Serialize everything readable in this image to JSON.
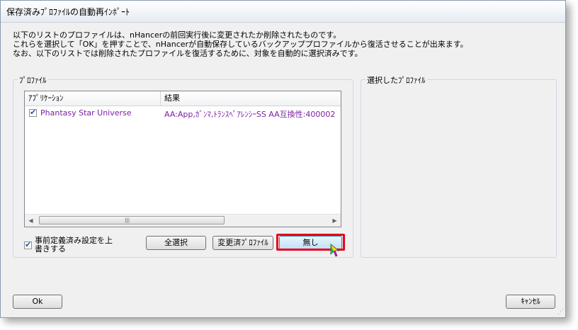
{
  "window": {
    "title": "保存済みﾌﾟﾛﾌｧｲﾙの自動再ｲﾝﾎﾟｰﾄ"
  },
  "description": {
    "line1": "以下のリストのプロファイルは、nHancerの前回実行後に変更されたか削除されたものです。",
    "line2": "これらを選択して「OK」を押すことで、nHancerが自動保存しているバックアッププロファイルから復活させることが出来ます。",
    "line3": "なお、以下のリストでは削除されたプロファイルを復活するために、対象を自動的に選択済みです。"
  },
  "profiles_group": {
    "label": "ﾌﾟﾛﾌｧｲﾙ"
  },
  "selected_group": {
    "label": "選択したﾌﾟﾛﾌｧｲﾙ"
  },
  "listview": {
    "columns": [
      "ｱﾌﾟﾘｹｰｼｮﾝ",
      "結果"
    ],
    "rows": [
      {
        "checked": true,
        "application": "Phantasy Star Universe",
        "result": "AA:App,ｶﾞﾝﾏ,ﾄﾗﾝｽﾍﾟｱﾚﾝｼｰSS AA互換性:400002"
      }
    ],
    "scroll_left_icon": "arrow-left-icon",
    "scroll_right_icon": "arrow-right-icon"
  },
  "overwrite_checkbox": {
    "checked": true,
    "label_line1": "事前定義済み設定を上",
    "label_line2": "書きする"
  },
  "buttons": {
    "select_all": "全選択",
    "changed_profiles": "変更済ﾌﾟﾛﾌｧｲﾙ",
    "none": "無し",
    "ok": "Ok",
    "cancel": "ｷｬﾝｾﾙ"
  },
  "colors": {
    "highlight": "#e8001c",
    "row_text": "#7a1fa0"
  }
}
